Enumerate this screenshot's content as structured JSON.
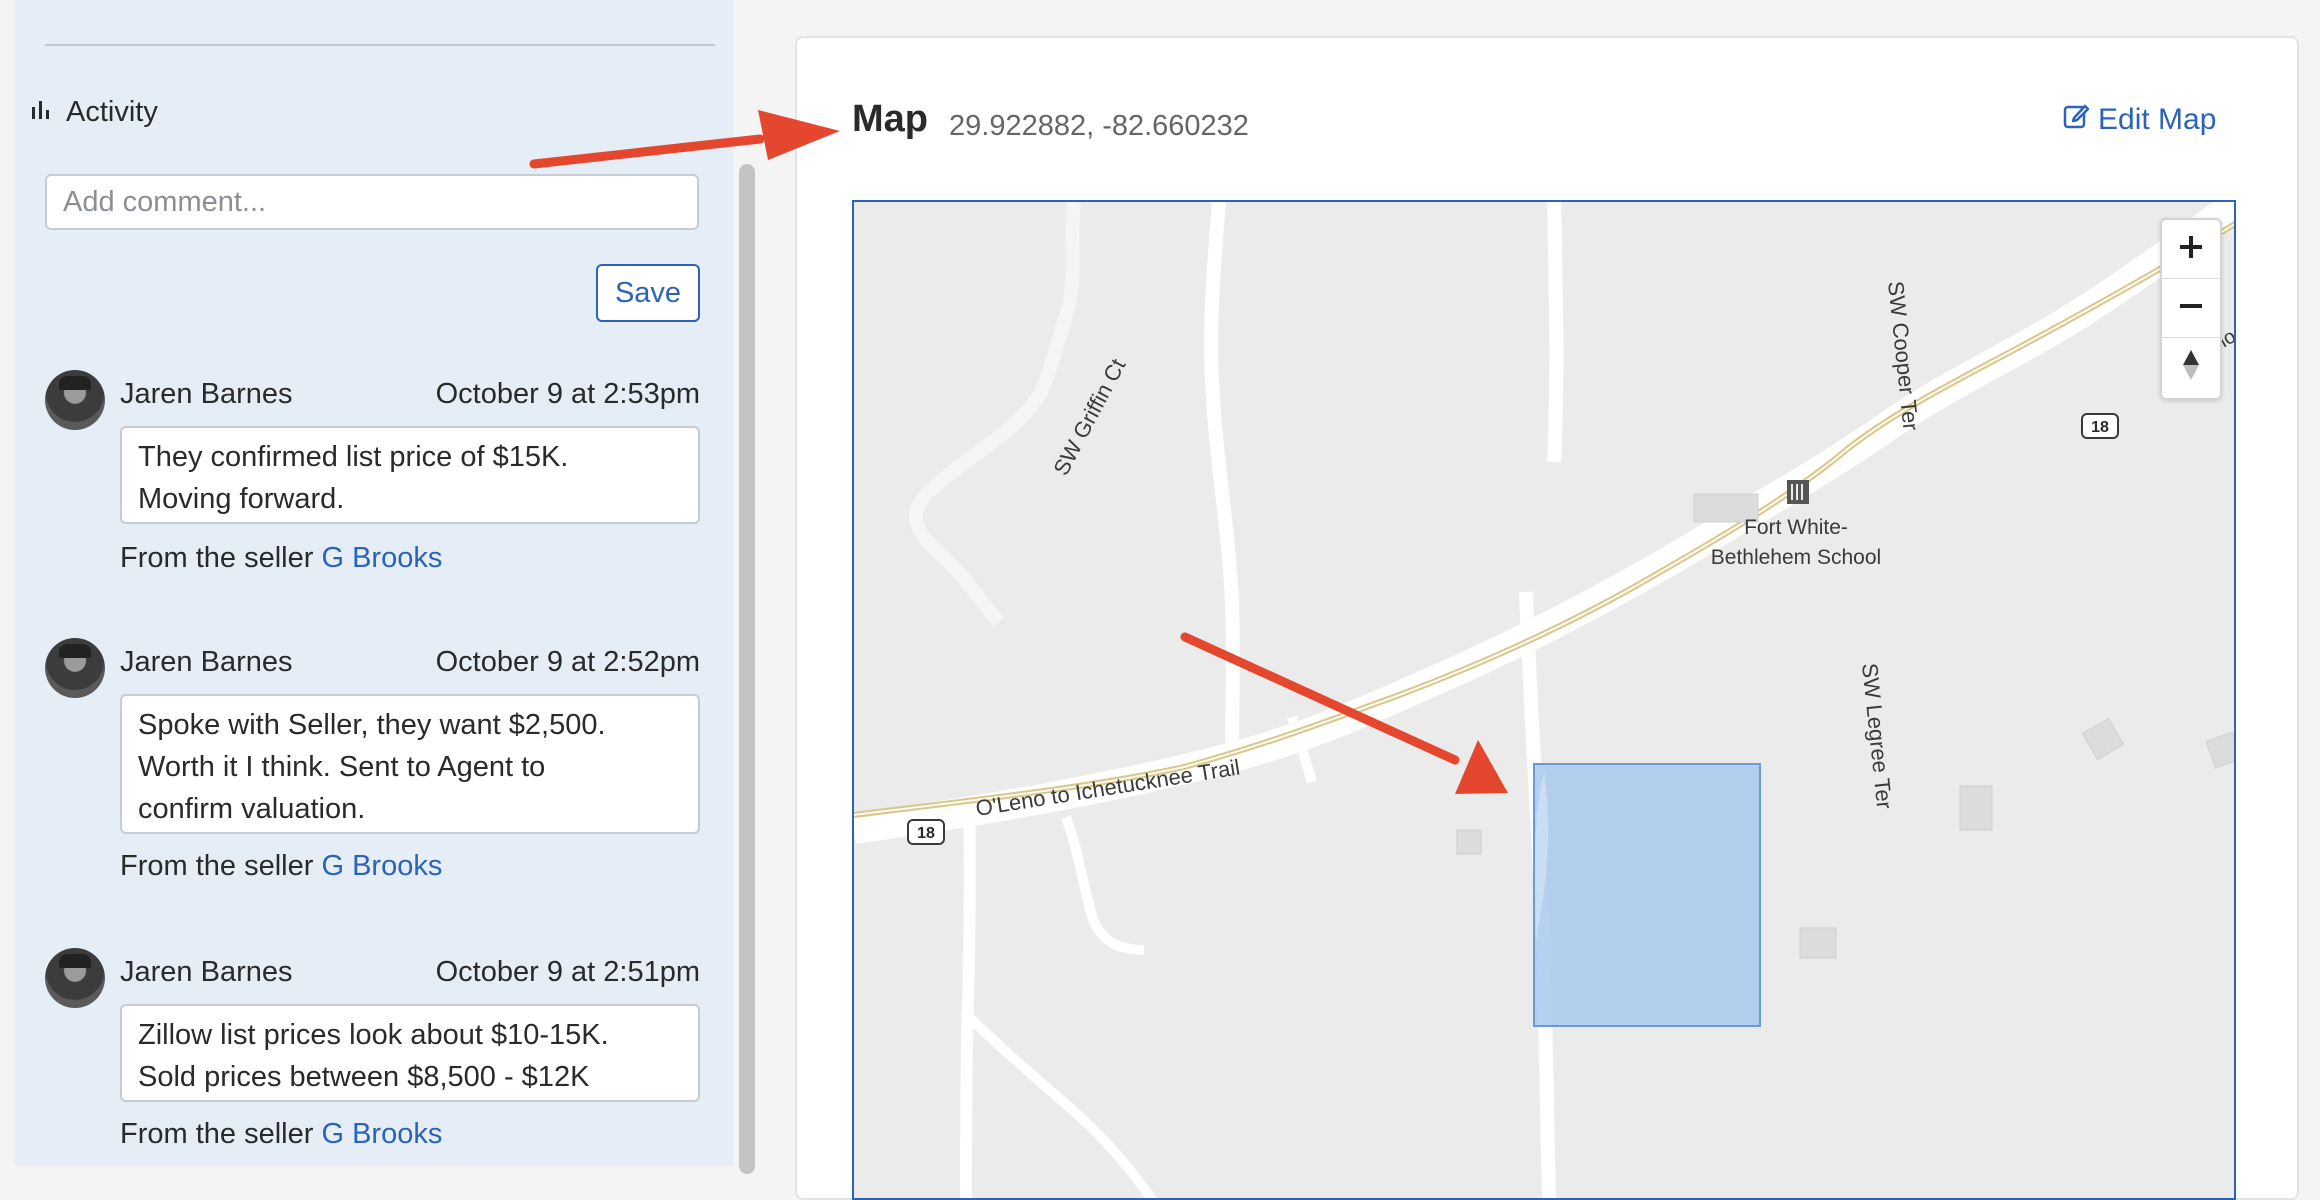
{
  "activity": {
    "title": "Activity",
    "comment_placeholder": "Add comment...",
    "save_label": "Save",
    "comments": [
      {
        "author": "Jaren Barnes",
        "time": "October 9 at 2:53pm",
        "text": "They confirmed list price of $15K.\nMoving forward.",
        "source_prefix": "From the seller",
        "source_link": "G Brooks"
      },
      {
        "author": "Jaren Barnes",
        "time": "October 9 at 2:52pm",
        "text": "Spoke with Seller, they want $2,500.\nWorth it I think. Sent to Agent to\nconfirm valuation.",
        "source_prefix": "From the seller",
        "source_link": "G Brooks"
      },
      {
        "author": "Jaren Barnes",
        "time": "October 9 at 2:51pm",
        "text": "Zillow list prices look about $10-15K.\nSold prices between $8,500 - $12K",
        "source_prefix": "From the seller",
        "source_link": "G Brooks"
      }
    ]
  },
  "map": {
    "title": "Map",
    "coordinates": "29.922882, -82.660232",
    "edit_label": "Edit Map",
    "labels": {
      "griffin": "SW Griffin Ct",
      "cooper": "SW Cooper Ter",
      "legree": "SW Legree Ter",
      "trail": "O'Leno to Ichetucknee Trail",
      "trail_end": "O'Leno to Ichetucknee Trail",
      "school_line1": "Fort White-",
      "school_line2": "Bethlehem School",
      "route": "18"
    },
    "controls": {
      "zoom_in": "+",
      "zoom_out": "−"
    }
  },
  "colors": {
    "accent": "#2b63b8",
    "panel_bg": "#e5eef6",
    "parcel_fill": "#a9c8ec",
    "arrow": "#e5462e"
  }
}
